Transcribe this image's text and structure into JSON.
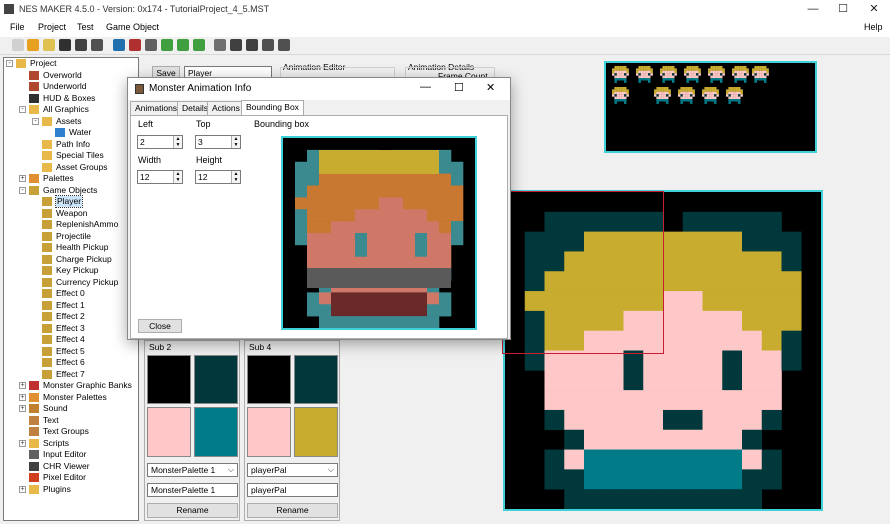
{
  "window": {
    "title": "NES MAKER 4.5.0 - Version: 0x174 - TutorialProject_4_5.MST",
    "minimize": "—",
    "maximize": "☐",
    "close": "✕"
  },
  "menu": {
    "file": "File",
    "project": "Project",
    "test": "Test",
    "game_object": "Game Object",
    "help": "Help"
  },
  "toolbar_icons": [
    "new-file",
    "open-folder",
    "open-file",
    "save",
    "save-as",
    "export",
    "globe",
    "book",
    "gear",
    "assemble-green",
    "assemble-green-2",
    "assemble-green-3",
    "build",
    "window",
    "monitor",
    "image-export",
    "chr-export"
  ],
  "tree": {
    "items": [
      {
        "label": "Project",
        "depth": 0,
        "exp": "-",
        "icon": "folder"
      },
      {
        "label": "Overworld",
        "depth": 1,
        "icon": "map"
      },
      {
        "label": "Underworld",
        "depth": 1,
        "icon": "map"
      },
      {
        "label": "HUD & Boxes",
        "depth": 1,
        "icon": "hud"
      },
      {
        "label": "All Graphics",
        "depth": 1,
        "exp": "-",
        "icon": "folder"
      },
      {
        "label": "Assets",
        "depth": 2,
        "exp": "-",
        "icon": "folder"
      },
      {
        "label": "Water",
        "depth": 3,
        "icon": "globe"
      },
      {
        "label": "Path Info",
        "depth": 2,
        "icon": "folder"
      },
      {
        "label": "Special Tiles",
        "depth": 2,
        "icon": "folder"
      },
      {
        "label": "Asset Groups",
        "depth": 2,
        "icon": "folder"
      },
      {
        "label": "Palettes",
        "depth": 1,
        "exp": "+",
        "icon": "palette"
      },
      {
        "label": "Game Objects",
        "depth": 1,
        "exp": "-",
        "icon": "character"
      },
      {
        "label": "Player",
        "depth": 2,
        "icon": "character",
        "selected": true
      },
      {
        "label": "Weapon",
        "depth": 2,
        "icon": "character"
      },
      {
        "label": "ReplenishAmmo",
        "depth": 2,
        "icon": "character"
      },
      {
        "label": "Projectile",
        "depth": 2,
        "icon": "character"
      },
      {
        "label": "Health Pickup",
        "depth": 2,
        "icon": "character"
      },
      {
        "label": "Charge Pickup",
        "depth": 2,
        "icon": "character"
      },
      {
        "label": "Key Pickup",
        "depth": 2,
        "icon": "character"
      },
      {
        "label": "Currency Pickup",
        "depth": 2,
        "icon": "character"
      },
      {
        "label": "Effect 0",
        "depth": 2,
        "icon": "character"
      },
      {
        "label": "Effect 1",
        "depth": 2,
        "icon": "character"
      },
      {
        "label": "Effect 2",
        "depth": 2,
        "icon": "character"
      },
      {
        "label": "Effect 3",
        "depth": 2,
        "icon": "character"
      },
      {
        "label": "Effect 4",
        "depth": 2,
        "icon": "character"
      },
      {
        "label": "Effect 5",
        "depth": 2,
        "icon": "character"
      },
      {
        "label": "Effect 6",
        "depth": 2,
        "icon": "character"
      },
      {
        "label": "Effect 7",
        "depth": 2,
        "icon": "character"
      },
      {
        "label": "Monster Graphic Banks",
        "depth": 1,
        "exp": "+",
        "icon": "monster"
      },
      {
        "label": "Monster Palettes",
        "depth": 1,
        "exp": "+",
        "icon": "palette"
      },
      {
        "label": "Sound",
        "depth": 1,
        "exp": "+",
        "icon": "sound"
      },
      {
        "label": "Text",
        "depth": 1,
        "icon": "text"
      },
      {
        "label": "Text Groups",
        "depth": 1,
        "icon": "text"
      },
      {
        "label": "Scripts",
        "depth": 1,
        "exp": "+",
        "icon": "folder"
      },
      {
        "label": "Input Editor",
        "depth": 1,
        "icon": "input"
      },
      {
        "label": "CHR Viewer",
        "depth": 1,
        "icon": "chr"
      },
      {
        "label": "Pixel Editor",
        "depth": 1,
        "icon": "pencil"
      },
      {
        "label": "Plugins",
        "depth": 1,
        "exp": "+",
        "icon": "folder"
      }
    ]
  },
  "editor": {
    "save_label": "Save",
    "name_value": "Player",
    "animation_editor_label": "Animation Editor",
    "animation_details_label": "Animation Details",
    "frame_count_label": "Frame Count",
    "sub2": {
      "label": "Sub 2",
      "swatches": [
        "#000000",
        "#00383c",
        "#ffc8c8",
        "#007c88"
      ],
      "palette_select": "MonsterPalette 1",
      "palette_name": "MonsterPalette 1",
      "rename_label": "Rename"
    },
    "sub4": {
      "label": "Sub 4",
      "swatches": [
        "#000000",
        "#00383c",
        "#ffc8c8",
        "#c8ac30"
      ],
      "palette_select": "playerPal",
      "palette_name": "playerPal",
      "rename_label": "Rename"
    }
  },
  "dialog": {
    "title": "Monster Animation Info",
    "tabs": [
      "Animations",
      "Details",
      "Actions",
      "Bounding Box"
    ],
    "active_tab": "Bounding Box",
    "left_label": "Left",
    "left_value": "2",
    "top_label": "Top",
    "top_value": "3",
    "width_label": "Width",
    "width_value": "12",
    "height_label": "Height",
    "height_value": "12",
    "bounding_box_label": "Bounding box",
    "close_label": "Close"
  },
  "colors": {
    "accent_cyan": "#3fd0d8",
    "sel_red": "#c81e32",
    "hair": "#c8ac30",
    "skin": "#ffc8c8",
    "dark_teal": "#00383c",
    "teal": "#007c88"
  }
}
